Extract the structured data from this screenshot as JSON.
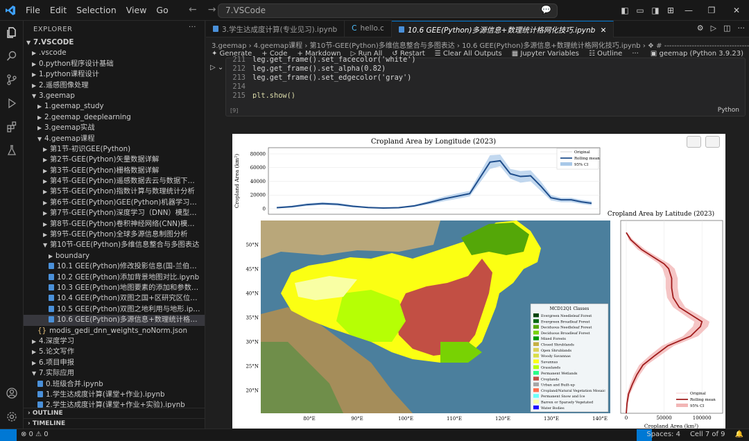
{
  "titlebar": {
    "menu": [
      "File",
      "Edit",
      "Selection",
      "View",
      "Go"
    ],
    "search_text": "7.VSCode"
  },
  "explorer": {
    "header": "EXPLORER",
    "more": "···",
    "root": "7.VSCODE",
    "items": [
      {
        "label": ".vscode",
        "depth": 1,
        "chev": "right"
      },
      {
        "label": "0.python程序设计基础",
        "depth": 1,
        "chev": "right"
      },
      {
        "label": "1.python课程设计",
        "depth": 1,
        "chev": "right"
      },
      {
        "label": "2.遥感图像处理",
        "depth": 1,
        "chev": "right"
      },
      {
        "label": "3.geemap",
        "depth": 1,
        "chev": "down"
      },
      {
        "label": "1.geemap_study",
        "depth": 2,
        "chev": "right"
      },
      {
        "label": "2.geemap_deeplearning",
        "depth": 2,
        "chev": "right"
      },
      {
        "label": "3.geemap实战",
        "depth": 2,
        "chev": "right"
      },
      {
        "label": "4.geemap课程",
        "depth": 2,
        "chev": "down"
      },
      {
        "label": "第1节-初识GEE(Python)",
        "depth": 3,
        "chev": "right"
      },
      {
        "label": "第2节-GEE(Python)矢量数据详解",
        "depth": 3,
        "chev": "right"
      },
      {
        "label": "第3节-GEE(Python)栅格数据详解",
        "depth": 3,
        "chev": "right"
      },
      {
        "label": "第4节-GEE(Python)遥感数据去云与数据下载详解",
        "depth": 3,
        "chev": "right"
      },
      {
        "label": "第5节-GEE(Python)指数计算与数理统计分析",
        "depth": 3,
        "chev": "right"
      },
      {
        "label": "第6节-GEE(Python)GEE(Python)机器学习与精度评估分...",
        "depth": 3,
        "chev": "right"
      },
      {
        "label": "第7节-GEE(Python)深度学习（DNN）模型构建",
        "depth": 3,
        "chev": "right"
      },
      {
        "label": "第8节-GEE(Python)卷积神经网络(CNN)模型构建",
        "depth": 3,
        "chev": "right"
      },
      {
        "label": "第9节-GEE(Python)全球多源信息制图分析",
        "depth": 3,
        "chev": "right"
      },
      {
        "label": "第10节-GEE(Python)多维信息整合与多图表达",
        "depth": 3,
        "chev": "down"
      },
      {
        "label": "boundary",
        "depth": 4,
        "chev": "right"
      },
      {
        "label": "10.1 GEE(Python)修改投影信息(国-兰伯特投影)对比.i...",
        "depth": 4,
        "chev": "file"
      },
      {
        "label": "10.2 GEE(Python)添加背景地图对比.ipynb",
        "depth": 4,
        "chev": "file"
      },
      {
        "label": "10.3 GEE(Python)地图要素的添加和参数设置.ipynb",
        "depth": 4,
        "chev": "file"
      },
      {
        "label": "10.4 GEE(Python)双图之国+区研究区位置图.ipynb",
        "depth": 4,
        "chev": "file"
      },
      {
        "label": "10.5 GEE(Python)双图之地利用与地形.ipynb",
        "depth": 4,
        "chev": "file"
      },
      {
        "label": "10.6 GEE(Python)多源信息+数理统计格网化技巧.ipynb",
        "depth": 4,
        "chev": "file",
        "selected": true
      },
      {
        "label": "modis_gedi_dnn_weights_noNorm.json",
        "depth": 2,
        "chev": "json"
      },
      {
        "label": "4.深度学习",
        "depth": 1,
        "chev": "right"
      },
      {
        "label": "5.论文写作",
        "depth": 1,
        "chev": "right"
      },
      {
        "label": "6.项目申报",
        "depth": 1,
        "chev": "right"
      },
      {
        "label": "7.实际应用",
        "depth": 1,
        "chev": "down"
      },
      {
        "label": "0.班级合并.ipynb",
        "depth": 2,
        "chev": "file"
      },
      {
        "label": "1.学生达成度计算(课堂+作业).ipynb",
        "depth": 2,
        "chev": "file"
      },
      {
        "label": "2.学生达成度计算(课堂+作业+实验).ipynb",
        "depth": 2,
        "chev": "file"
      }
    ],
    "sections": [
      "OUTLINE",
      "TIMELINE"
    ]
  },
  "tabs": [
    {
      "label": "3.学生达成度计算(专业见习).ipynb",
      "kind": "nb"
    },
    {
      "label": "hello.c",
      "kind": "c"
    },
    {
      "label": "10.6 GEE(Python)多源信息+数理统计格网化技巧.ipynb",
      "kind": "nb",
      "active": true
    }
  ],
  "breadcrumb": "3.geemap  ›  4.geemap课程  ›  第10节-GEE(Python)多维信息整合与多图表达  ›  10.6 GEE(Python)多源信息+数理统计格网化技巧.ipynb  ›  ❖  # ----------------------------------",
  "toolbar": {
    "items": [
      "✦ Generate",
      "+ Code",
      "+ Markdown",
      "▷ Run All",
      "↺ Restart",
      "☰ Clear All Outputs",
      "▦ Jupyter Variables",
      "☷ Outline",
      "···"
    ],
    "kernel": "geemap (Python 3.9.23)"
  },
  "code": {
    "lines": [
      {
        "n": "211",
        "text": "leg.get_frame().set_facecolor('white')"
      },
      {
        "n": "212",
        "text": "leg.get_frame().set_alpha(0.82)"
      },
      {
        "n": "213",
        "text": "leg.get_frame().set_edgecolor('gray')"
      },
      {
        "n": "214",
        "text": ""
      },
      {
        "n": "215",
        "text": "plt.show()"
      }
    ],
    "exec_count": "[9]",
    "lang": "Python"
  },
  "statusbar": {
    "problems": "⊗ 0  ⚠ 0",
    "spaces": "Spaces: 4",
    "cell": "Cell 7 of 9"
  },
  "chart_data": [
    {
      "type": "area",
      "title": "Cropland Area by Longitude (2023)",
      "ylabel": "Cropland Area (km²)",
      "yticks": [
        "0",
        "20000",
        "40000",
        "60000",
        "80000"
      ],
      "ylim": [
        0,
        85000
      ],
      "xlim": [
        73,
        135
      ],
      "legend": [
        "Original",
        "Rolling mean",
        "95% CI"
      ],
      "legend_position": "upper-right",
      "x": [
        73,
        76,
        79,
        82,
        85,
        88,
        91,
        94,
        97,
        100,
        103,
        106,
        109,
        111,
        113,
        115,
        117,
        119,
        121,
        123,
        125,
        127,
        129,
        131,
        133,
        135
      ],
      "rolling_mean": [
        1500,
        3000,
        6000,
        7500,
        6500,
        3500,
        1800,
        1000,
        1500,
        4000,
        9000,
        14500,
        19000,
        22000,
        45000,
        68000,
        70000,
        51000,
        47000,
        48000,
        33000,
        16000,
        13000,
        13000,
        10000,
        8000
      ],
      "ci_low": [
        500,
        1500,
        4000,
        5500,
        4500,
        2000,
        800,
        300,
        500,
        2500,
        6500,
        11000,
        15000,
        18000,
        38000,
        58000,
        62000,
        44000,
        38000,
        40000,
        26000,
        12000,
        9500,
        9500,
        7000,
        5000
      ],
      "ci_high": [
        2500,
        4500,
        8000,
        9500,
        8500,
        5000,
        2800,
        1800,
        2500,
        5500,
        11500,
        18000,
        23000,
        26000,
        52000,
        78000,
        79000,
        58000,
        55000,
        56000,
        40000,
        20000,
        16000,
        16000,
        13000,
        11000
      ],
      "color": "#1f4e8c",
      "ci_color": "#a8c8e8"
    },
    {
      "type": "area",
      "title": "Cropland Area by Latitude (2023)",
      "xlabel": "Cropland Area (km²)",
      "xticks": [
        "0",
        "50000",
        "100000"
      ],
      "xlim": [
        0,
        120000
      ],
      "ylim": [
        16,
        56
      ],
      "legend": [
        "Original",
        "Rolling mean",
        "95% CI"
      ],
      "legend_position": "lower-right",
      "y": [
        16,
        18,
        20,
        22,
        24,
        26,
        28,
        30,
        32,
        34,
        35,
        36,
        38,
        40,
        42,
        44,
        46,
        47,
        48,
        50,
        52,
        53.5
      ],
      "rolling_mean": [
        0,
        1000,
        3000,
        8000,
        14000,
        22000,
        38000,
        55000,
        85000,
        98000,
        100000,
        90000,
        70000,
        62000,
        60000,
        60000,
        56000,
        50000,
        40000,
        20000,
        6000,
        0
      ],
      "ci_low": [
        0,
        0,
        1000,
        5000,
        10000,
        17000,
        31000,
        47000,
        75000,
        88000,
        90000,
        80000,
        62000,
        54000,
        52000,
        52000,
        48000,
        43000,
        34000,
        15000,
        3000,
        0
      ],
      "ci_high": [
        1000,
        2000,
        5000,
        11000,
        18000,
        27000,
        45000,
        63000,
        95000,
        108000,
        110000,
        100000,
        78000,
        70000,
        68000,
        68000,
        64000,
        57000,
        46000,
        25000,
        9000,
        1000
      ],
      "color": "#a01c1c",
      "ci_color": "#f2b6b6"
    }
  ],
  "map": {
    "lat_ticks": [
      "50°N",
      "45°N",
      "40°N",
      "35°N",
      "30°N",
      "25°N",
      "20°N"
    ],
    "lon_ticks": [
      "80°E",
      "90°E",
      "100°E",
      "110°E",
      "120°E",
      "130°E",
      "140°E"
    ],
    "legend_title": "MCD12Q1 Classes",
    "classes": [
      {
        "name": "Evergreen Needleleaf Forest",
        "color": "#05450a"
      },
      {
        "name": "Evergreen Broadleaf Forest",
        "color": "#086a10"
      },
      {
        "name": "Deciduous Needleleaf Forest",
        "color": "#54a708"
      },
      {
        "name": "Deciduous Broadleaf Forest",
        "color": "#78d203"
      },
      {
        "name": "Mixed Forests",
        "color": "#009900"
      },
      {
        "name": "Closed Shrublands",
        "color": "#c6b044"
      },
      {
        "name": "Open Shrublands",
        "color": "#dcd159"
      },
      {
        "name": "Woody Savannas",
        "color": "#dade48"
      },
      {
        "name": "Savannas",
        "color": "#fbff13"
      },
      {
        "name": "Grasslands",
        "color": "#b6ff05"
      },
      {
        "name": "Permanent Wetlands",
        "color": "#27ff87"
      },
      {
        "name": "Croplands",
        "color": "#c24f44"
      },
      {
        "name": "Urban and Built-up",
        "color": "#a5a5a5"
      },
      {
        "name": "Cropland/Natural Vegetation Mosaic",
        "color": "#ff6d4c"
      },
      {
        "name": "Permanent Snow and Ice",
        "color": "#69fff8"
      },
      {
        "name": "Barren or Sparsely Vegetated",
        "color": "#f9ffa4"
      },
      {
        "name": "Water Bodies",
        "color": "#1c0dff"
      }
    ]
  }
}
